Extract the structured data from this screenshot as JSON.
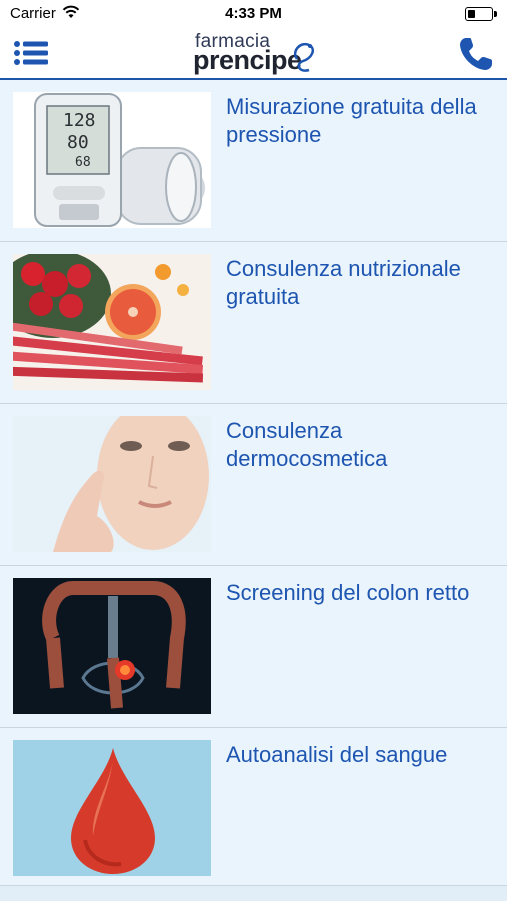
{
  "status_bar": {
    "carrier": "Carrier",
    "time": "4:33 PM"
  },
  "header": {
    "logo_line1": "farmacia",
    "logo_line2": "prencipe"
  },
  "services": [
    {
      "title": "Misurazione gratuita della pressione",
      "image": "blood-pressure-monitor-image"
    },
    {
      "title": "Consulenza nutrizionale gratuita",
      "image": "fruit-and-rhubarb-image"
    },
    {
      "title": "Consulenza dermocosmetica",
      "image": "woman-face-skincare-image"
    },
    {
      "title": "Screening del colon retto",
      "image": "colon-xray-image"
    },
    {
      "title": "Autoanalisi del sangue",
      "image": "blood-drop-image"
    }
  ],
  "colors": {
    "accent": "#1d55b0",
    "background": "#eaf4fc",
    "divider": "#c9d6e2"
  },
  "icons": [
    "wifi-icon",
    "battery-icon",
    "menu-icon",
    "phone-icon"
  ]
}
